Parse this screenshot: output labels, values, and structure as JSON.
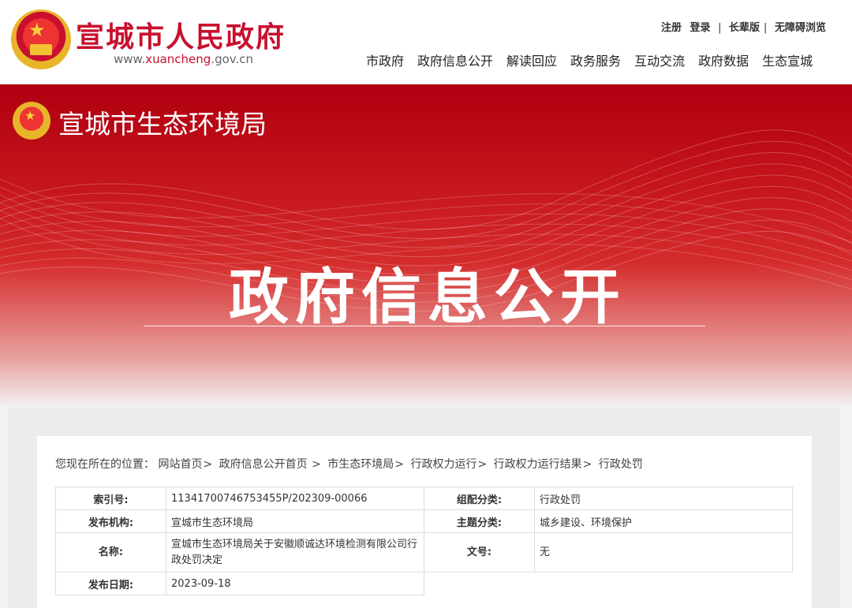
{
  "header": {
    "site_title": "宣城市人民政府",
    "site_url_prefix": "www.",
    "site_url_domain": "xuancheng",
    "site_url_suffix": ".gov.cn",
    "util_links": [
      "注册",
      "登录",
      "长辈版",
      "无障碍浏览"
    ],
    "nav": [
      "市政府",
      "政府信息公开",
      "解读回应",
      "政务服务",
      "互动交流",
      "政府数据",
      "生态宣城"
    ]
  },
  "banner": {
    "dept_title": "宣城市生态环境局",
    "heading": "政府信息公开"
  },
  "breadcrumb": {
    "prefix": "您现在所在的位置：",
    "items": [
      "网站首页",
      "政府信息公开首页",
      "市生态环境局",
      "行政权力运行",
      "行政权力运行结果",
      "行政处罚"
    ]
  },
  "info": {
    "index_label": "索引号:",
    "index_value": "11341700746753455P/202309-00066",
    "category_label": "组配分类:",
    "category_value": "行政处罚",
    "publisher_label": "发布机构:",
    "publisher_value": "宣城市生态环境局",
    "topic_label": "主题分类:",
    "topic_value": "城乡建设、环境保护",
    "name_label": "名称:",
    "name_value": "宣城市生态环境局关于安徽顺诚达环境检测有限公司行政处罚决定",
    "docno_label": "文号:",
    "docno_value": "无",
    "date_label": "发布日期:",
    "date_value": "2023-09-18"
  },
  "colors": {
    "brand_red": "#c8102e",
    "banner_red": "#c4141c"
  }
}
